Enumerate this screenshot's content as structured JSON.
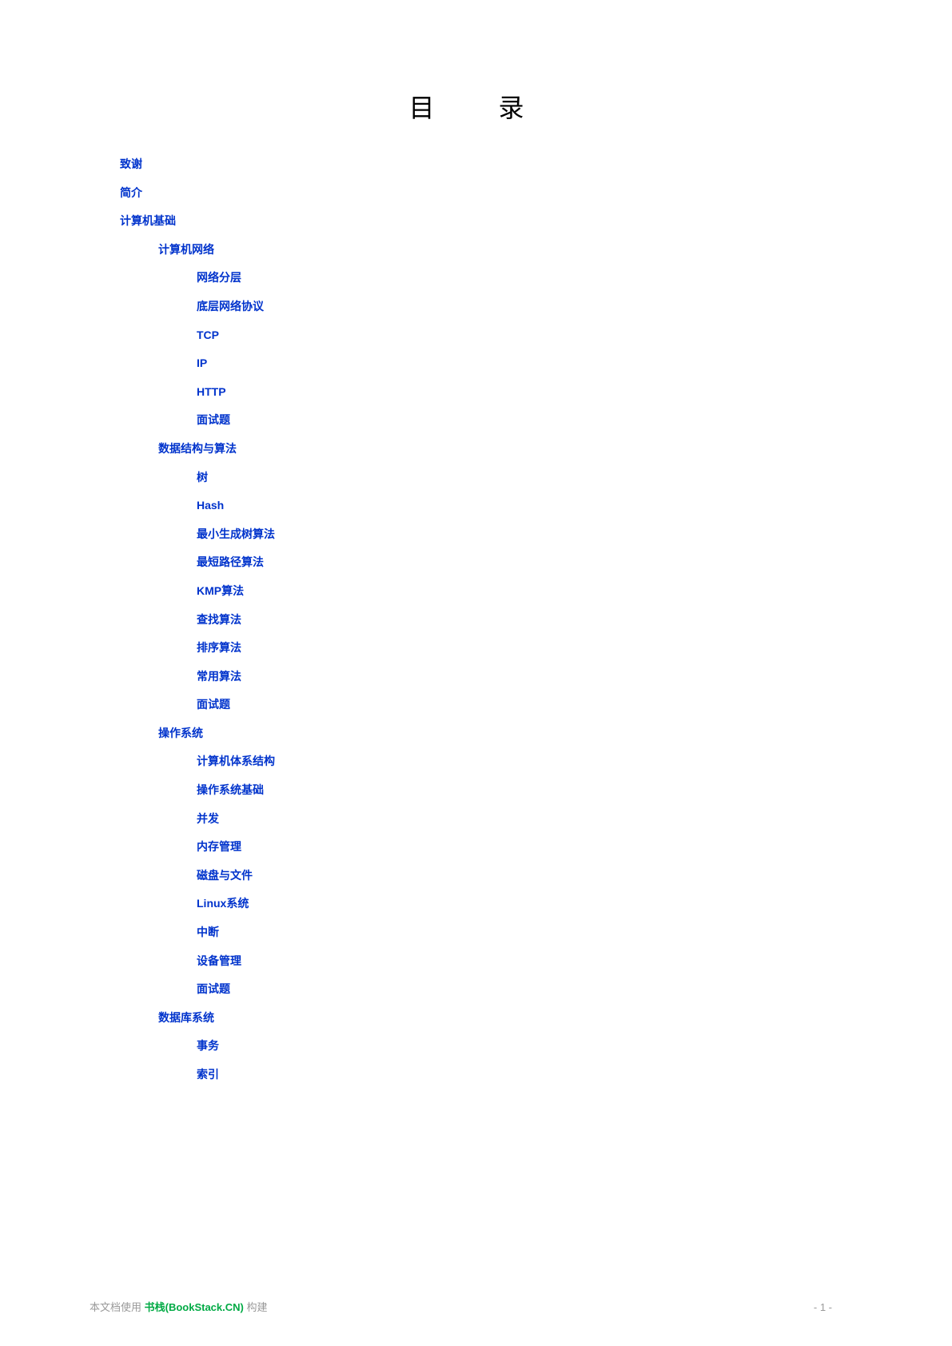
{
  "title": "目　录",
  "toc": [
    {
      "label": "致谢",
      "level": 0
    },
    {
      "label": "简介",
      "level": 0
    },
    {
      "label": "计算机基础",
      "level": 0
    },
    {
      "label": "计算机网络",
      "level": 1
    },
    {
      "label": "网络分层",
      "level": 2
    },
    {
      "label": "底层网络协议",
      "level": 2
    },
    {
      "label": "TCP",
      "level": 2
    },
    {
      "label": "IP",
      "level": 2
    },
    {
      "label": "HTTP",
      "level": 2
    },
    {
      "label": "面试题",
      "level": 2
    },
    {
      "label": "数据结构与算法",
      "level": 1
    },
    {
      "label": "树",
      "level": 2
    },
    {
      "label": "Hash",
      "level": 2
    },
    {
      "label": "最小生成树算法",
      "level": 2
    },
    {
      "label": "最短路径算法",
      "level": 2
    },
    {
      "label": "KMP算法",
      "level": 2
    },
    {
      "label": "查找算法",
      "level": 2
    },
    {
      "label": "排序算法",
      "level": 2
    },
    {
      "label": "常用算法",
      "level": 2
    },
    {
      "label": "面试题",
      "level": 2
    },
    {
      "label": "操作系统",
      "level": 1
    },
    {
      "label": "计算机体系结构",
      "level": 2
    },
    {
      "label": "操作系统基础",
      "level": 2
    },
    {
      "label": "并发",
      "level": 2
    },
    {
      "label": "内存管理",
      "level": 2
    },
    {
      "label": "磁盘与文件",
      "level": 2
    },
    {
      "label": "Linux系统",
      "level": 2
    },
    {
      "label": "中断",
      "level": 2
    },
    {
      "label": "设备管理",
      "level": 2
    },
    {
      "label": "面试题",
      "level": 2
    },
    {
      "label": "数据库系统",
      "level": 1
    },
    {
      "label": "事务",
      "level": 2
    },
    {
      "label": "索引",
      "level": 2
    }
  ],
  "footer": {
    "prefix": "本文档使用 ",
    "link": "书栈(BookStack.CN)",
    "suffix": " 构建",
    "page": "- 1 -"
  }
}
